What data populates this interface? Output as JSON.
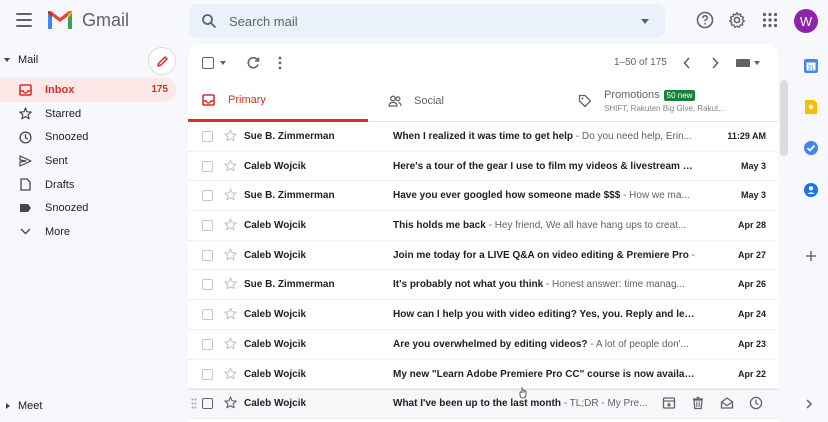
{
  "app": {
    "name": "Gmail"
  },
  "search": {
    "placeholder": "Search mail"
  },
  "account": {
    "initial": "W",
    "color": "#8e24aa"
  },
  "sidebar": {
    "mail_label": "Mail",
    "items": [
      {
        "label": "Inbox",
        "count": "175"
      },
      {
        "label": "Starred",
        "count": ""
      },
      {
        "label": "Snoozed",
        "count": ""
      },
      {
        "label": "Sent",
        "count": ""
      },
      {
        "label": "Drafts",
        "count": ""
      },
      {
        "label": "Snoozed",
        "count": ""
      },
      {
        "label": "More",
        "count": ""
      }
    ],
    "meet_label": "Meet"
  },
  "toolbar": {
    "range": "1–50 of 175"
  },
  "tabs": {
    "primary": "Primary",
    "social": "Social",
    "promotions": "Promotions",
    "promotions_badge": "50 new",
    "promotions_sub": "SHIFT, Rakuten Big Give, Rakut..."
  },
  "emails": [
    {
      "sender": "Sue B. Zimmerman",
      "subject": "When I realized it was time to get help",
      "snippet": " - Do you need help, Erin...",
      "date": "11:29 AM"
    },
    {
      "sender": "Caleb Wojcik",
      "subject": "Here's a tour of the gear I use to film my videos & livestream",
      "snippet": " - H",
      "date": "May 3"
    },
    {
      "sender": "Sue B. Zimmerman",
      "subject": "Have you ever googled how someone made $$$",
      "snippet": " - How we ma...",
      "date": "May 3"
    },
    {
      "sender": "Caleb Wojcik",
      "subject": "This holds me back",
      "snippet": " - Hey friend, We all have hang ups to creat...",
      "date": "Apr 28"
    },
    {
      "sender": "Caleb Wojcik",
      "subject": "Join me today for a LIVE Q&A on video editing & Premiere Pro",
      "snippet": " -",
      "date": "Apr 27"
    },
    {
      "sender": "Sue B. Zimmerman",
      "subject": "It's probably not what you think",
      "snippet": " - Honest answer: time manag...",
      "date": "Apr 26"
    },
    {
      "sender": "Caleb Wojcik",
      "subject": "How can I help you with video editing? Yes, you. Reply and let...",
      "snippet": "",
      "date": "Apr 24"
    },
    {
      "sender": "Caleb Wojcik",
      "subject": "Are you overwhelmed by editing videos?",
      "snippet": " - A lot of people don'...",
      "date": "Apr 23"
    },
    {
      "sender": "Caleb Wojcik",
      "subject": "My new \"Learn Adobe Premiere Pro CC\" course is now availab...",
      "snippet": "",
      "date": "Apr 22"
    },
    {
      "sender": "Caleb Wojcik",
      "subject": "What I've been up to the last month",
      "snippet": " - TL;DR - My Pre...",
      "date": ""
    }
  ],
  "colors": {
    "accent_red": "#d93025",
    "badge_green": "#188038",
    "search_bg": "#eaf1fb"
  }
}
